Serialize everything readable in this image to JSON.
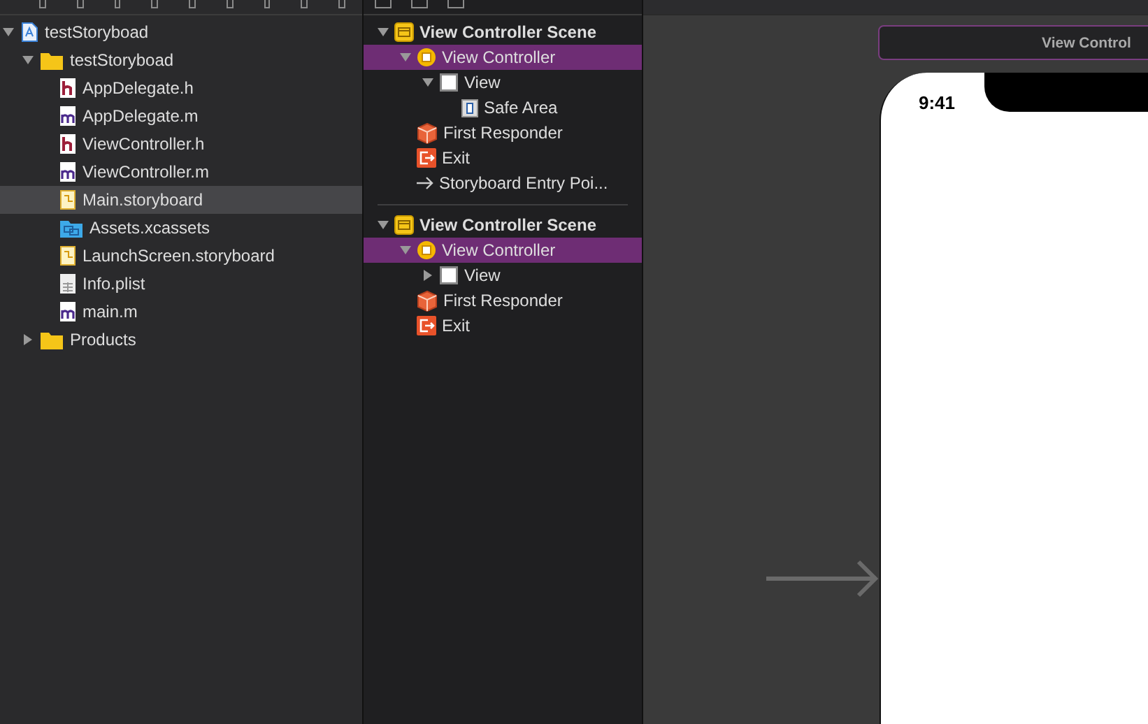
{
  "navigator": {
    "items": [
      {
        "label": "testStoryboad",
        "kind": "project",
        "expanded": true,
        "selected": false,
        "children": [
          {
            "label": "testStoryboad",
            "kind": "folder",
            "expanded": true,
            "selected": false,
            "children": [
              {
                "label": "AppDelegate.h",
                "kind": "header",
                "selected": false
              },
              {
                "label": "AppDelegate.m",
                "kind": "source",
                "selected": false
              },
              {
                "label": "ViewController.h",
                "kind": "header",
                "selected": false
              },
              {
                "label": "ViewController.m",
                "kind": "source",
                "selected": false
              },
              {
                "label": "Main.storyboard",
                "kind": "storyboard",
                "selected": true
              },
              {
                "label": "Assets.xcassets",
                "kind": "assets",
                "selected": false
              },
              {
                "label": "LaunchScreen.storyboard",
                "kind": "storyboard",
                "selected": false
              },
              {
                "label": "Info.plist",
                "kind": "plist",
                "selected": false
              },
              {
                "label": "main.m",
                "kind": "source",
                "selected": false
              }
            ]
          },
          {
            "label": "Products",
            "kind": "folder",
            "expanded": false,
            "selected": false
          }
        ]
      }
    ]
  },
  "outline": {
    "scenes": [
      {
        "label": "View Controller Scene",
        "kind": "scene",
        "expanded": true,
        "selected": false,
        "children": [
          {
            "label": "View Controller",
            "kind": "controller",
            "expanded": true,
            "selected": true,
            "children": [
              {
                "label": "View",
                "kind": "view",
                "expanded": true,
                "selected": false,
                "children": [
                  {
                    "label": "Safe Area",
                    "kind": "safearea",
                    "selected": false
                  }
                ]
              }
            ]
          },
          {
            "label": "First Responder",
            "kind": "responder",
            "selected": false
          },
          {
            "label": "Exit",
            "kind": "exit",
            "selected": false
          },
          {
            "label": "Storyboard Entry Poi...",
            "kind": "entry",
            "selected": false
          }
        ]
      },
      {
        "label": "View Controller Scene",
        "kind": "scene",
        "expanded": true,
        "selected": false,
        "children": [
          {
            "label": "View Controller",
            "kind": "controller",
            "expanded": true,
            "selected": true,
            "children": [
              {
                "label": "View",
                "kind": "view",
                "expanded": false,
                "selected": false
              }
            ]
          },
          {
            "label": "First Responder",
            "kind": "responder",
            "selected": false
          },
          {
            "label": "Exit",
            "kind": "exit",
            "selected": false
          }
        ]
      }
    ]
  },
  "canvas": {
    "scene_title": "View Control",
    "status_time": "9:41"
  }
}
